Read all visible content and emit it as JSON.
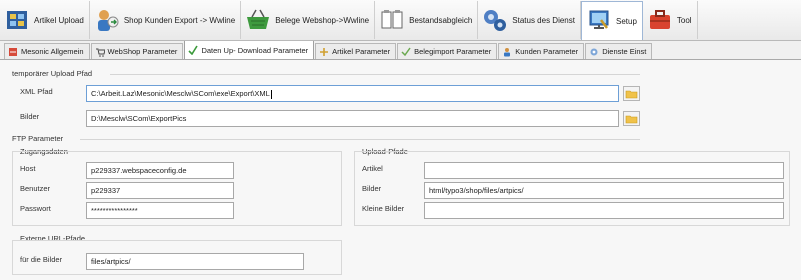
{
  "toolbar": {
    "items": [
      {
        "label": "Artikel Upload",
        "icon": "artikel-upload-icon"
      },
      {
        "label": "Shop Kunden Export -> Wwline",
        "icon": "shop-kunden-icon"
      },
      {
        "label": "Belege Webshop->Wwline",
        "icon": "belege-basket-icon"
      },
      {
        "label": "Bestandsabgleich",
        "icon": "bestandsabgleich-icon"
      },
      {
        "label": "Status des Dienst",
        "icon": "status-dienst-icon"
      },
      {
        "label": "Setup",
        "icon": "setup-icon"
      },
      {
        "label": "Tool",
        "icon": "tools-icon"
      }
    ]
  },
  "tabs": [
    {
      "label": "Mesonic Allgemein",
      "icon": "mesonic-icon"
    },
    {
      "label": "WebShop Parameter",
      "icon": "cart-icon"
    },
    {
      "label": "Daten Up- Download Parameter",
      "icon": "transfer-icon"
    },
    {
      "label": "Artikel Parameter",
      "icon": "artikel-icon"
    },
    {
      "label": "Belegimport Parameter",
      "icon": "belegimport-icon"
    },
    {
      "label": "Kunden Parameter",
      "icon": "kunden-icon"
    },
    {
      "label": "Dienste Einst",
      "icon": "dienste-icon"
    }
  ],
  "upload_path": {
    "title": "temporärer Upload Pfad",
    "xml_label": "XML Pfad",
    "xml_value": "C:\\Arbeit.Laz\\Mesonic\\Mesclw\\SCom\\exe\\Export\\XML",
    "bilder_label": "Bilder",
    "bilder_value": "D:\\Mesclw\\SCom\\ExportPics"
  },
  "ftp": {
    "title": "FTP Parameter",
    "zugang_title": "Zugangsdaten",
    "host_label": "Host",
    "host_value": "p229337.webspaceconfig.de",
    "benutzer_label": "Benutzer",
    "benutzer_value": "p229337",
    "passwort_label": "Passwort",
    "passwort_value": "****************",
    "upload_title": "Upload-Pfade",
    "artikel_label": "Artikel",
    "artikel_value": "",
    "bilder_label": "Bilder",
    "bilder_value": "html/typo3/shop/files/artpics/",
    "kleine_label": "Kleine Bilder",
    "kleine_value": ""
  },
  "extern": {
    "title": "Externe URL-Pfade",
    "bilder_label": "für die Bilder",
    "bilder_value": "files/artpics/"
  }
}
